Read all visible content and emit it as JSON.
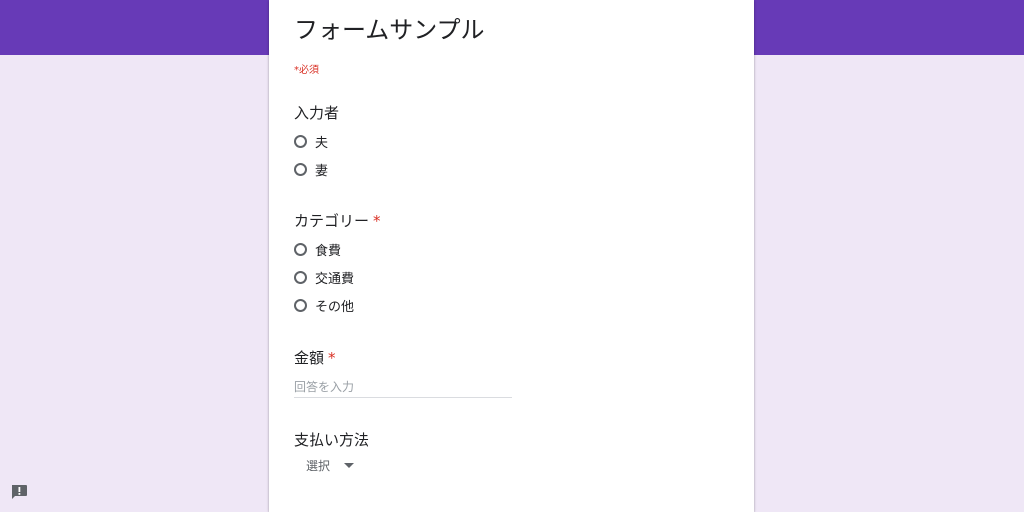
{
  "form": {
    "title": "フォームサンプル",
    "required_note": "*必須",
    "accent_color": "#673ab7",
    "page_background": "#efe7f6"
  },
  "questions": {
    "q1": {
      "title": "入力者",
      "required": false,
      "options": [
        "夫",
        "妻"
      ]
    },
    "q2": {
      "title": "カテゴリー",
      "required": true,
      "required_mark": "*",
      "options": [
        "食費",
        "交通費",
        "その他"
      ]
    },
    "q3": {
      "title": "金額",
      "required": true,
      "required_mark": "*",
      "placeholder": "回答を入力",
      "value": ""
    },
    "q4": {
      "title": "支払い方法",
      "required": false,
      "dropdown_value": "選択"
    }
  },
  "icons": {
    "dropdown": "triangle-down",
    "feedback": "report-feedback-icon"
  },
  "colors": {
    "required": "#d93025",
    "text": "#202124",
    "secondary_text": "#5f6368"
  }
}
